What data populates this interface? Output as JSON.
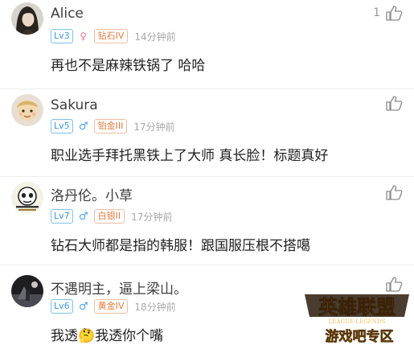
{
  "comments": [
    {
      "username": "Alice",
      "level": "Lv3",
      "gender_icon": "female-icon",
      "gender_symbol": "♀",
      "rank": "钻石IV",
      "time": "14分钟前",
      "text": "再也不是麻辣铁锅了 哈哈",
      "like_count": "1"
    },
    {
      "username": "Sakura",
      "level": "Lv5",
      "gender_icon": "male-icon",
      "gender_symbol": "♂",
      "rank": "铂金III",
      "time": "17分钟前",
      "text": "职业选手拜托黑铁上了大师 真长脸！标题真好",
      "like_count": ""
    },
    {
      "username": "洛丹伦。小草",
      "level": "Lv7",
      "gender_icon": "male-icon",
      "gender_symbol": "♂",
      "rank": "白银II",
      "time": "17分钟前",
      "text": "钻石大师都是指的韩服！跟国服压根不搭噶",
      "like_count": ""
    },
    {
      "username": "不遇明主，逼上梁山。",
      "level": "Lv6",
      "gender_icon": "male-icon",
      "gender_symbol": "♂",
      "rank": "黄金IV",
      "time": "18分钟前",
      "text_before": "我透",
      "text_emoji": "🤔",
      "text_after": "我透你个嘴",
      "like_count": ""
    }
  ],
  "watermark": {
    "logo_title": "英雄联盟",
    "logo_subtitle": "LEAGUE·LEGENDS",
    "caption": "游戏吧专区"
  },
  "colors": {
    "level_badge": "#3b9ad9",
    "rank_badge": "#e27c3f",
    "male": "#4aa3e8",
    "female": "#e57a9a",
    "time": "#a8a8a8"
  }
}
